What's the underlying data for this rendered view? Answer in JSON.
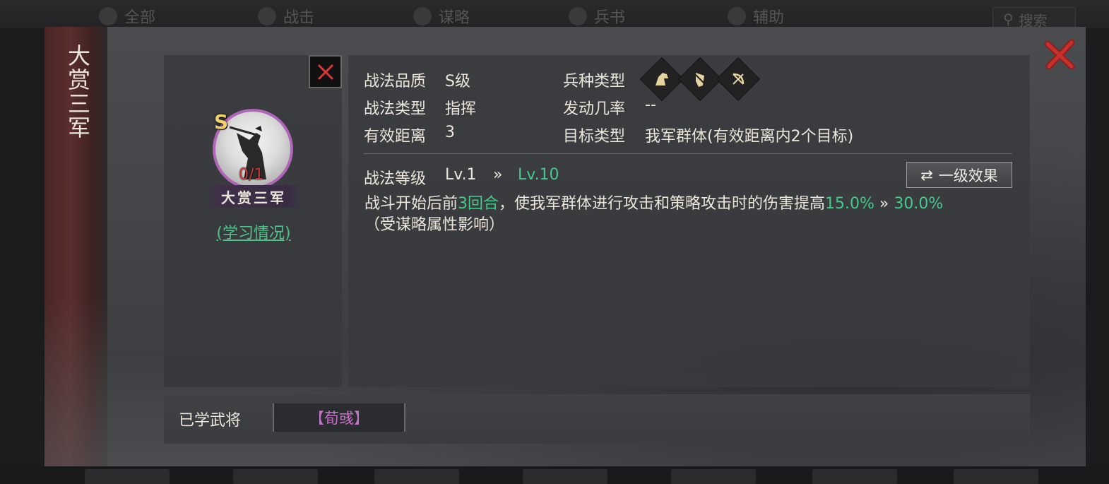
{
  "background": {
    "top_tabs": [
      {
        "icon": "grid-icon",
        "label": "全部"
      },
      {
        "icon": "swords-icon",
        "label": "战击"
      },
      {
        "icon": "tactic-icon",
        "label": "谋略"
      },
      {
        "icon": "horse-icon",
        "label": "兵书"
      },
      {
        "icon": "support-icon",
        "label": "辅助"
      }
    ],
    "search_label": "搜索"
  },
  "modal": {
    "title": "大赏三军",
    "close_icon": "close-icon",
    "skill": {
      "grade": "S",
      "progress": "0/1",
      "name": "大赏三军",
      "study_link": "(学习情况)"
    },
    "info": {
      "quality_label": "战法品质",
      "quality_value": "S级",
      "type_label": "战法类型",
      "type_value": "指挥",
      "range_label": "有效距离",
      "range_value": "3",
      "unit_label": "兵种类型",
      "unit_icons": [
        "cavalry-icon",
        "shield-icon",
        "archer-icon"
      ],
      "chance_label": "发动几率",
      "chance_value": "--",
      "target_label": "目标类型",
      "target_value": "我军群体(有效距离内2个目标)",
      "level_label": "战法等级",
      "level_from": "Lv.1",
      "level_arrow": "»",
      "level_to": "Lv.10",
      "effect_button": "一级效果",
      "desc": {
        "p1": "战斗开始后前",
        "rounds": "3回合",
        "p2": "，使我军群体进行攻击和策略攻击时的伤害提高",
        "from": "15.0%",
        "arrow": "»",
        "to": "30.0%",
        "note": "（受谋略属性影响）"
      }
    },
    "learned": {
      "label": "已学武将",
      "generals": [
        "【荀彧】"
      ]
    }
  },
  "colors": {
    "accent_green": "#44c98a",
    "portrait_border": "#b165b8",
    "general_name": "#c473c9",
    "close_red": "#c8302c"
  }
}
